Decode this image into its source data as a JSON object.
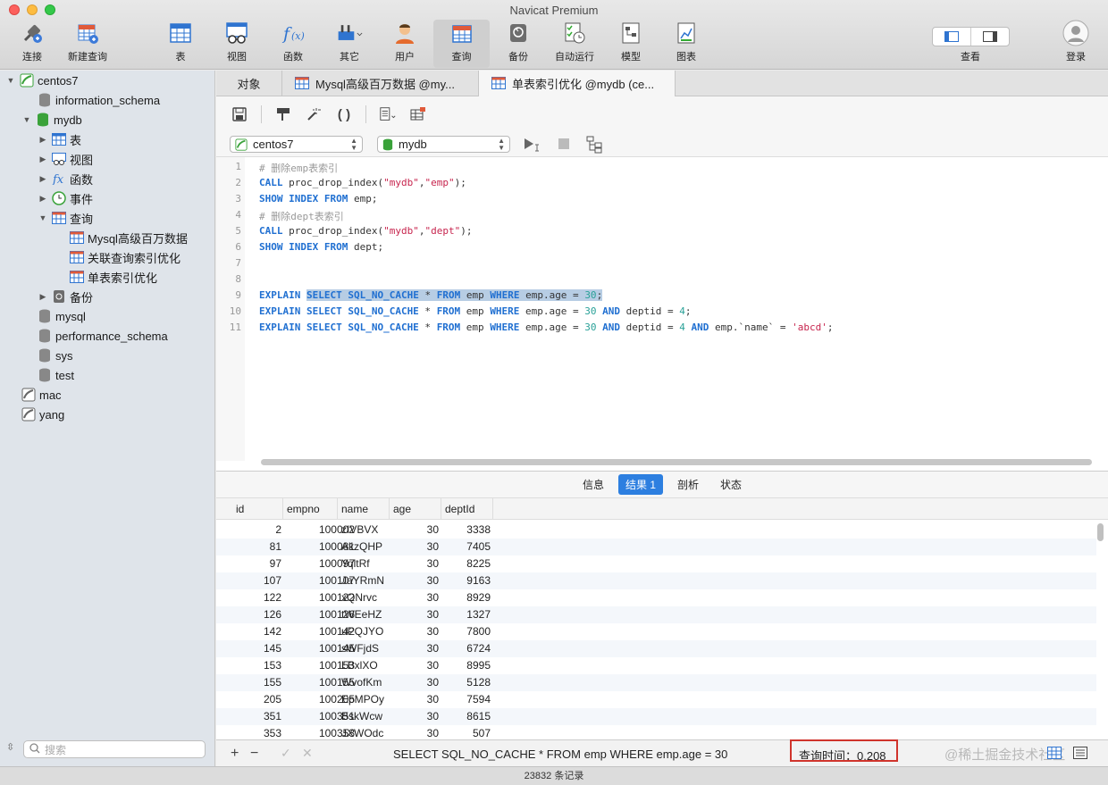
{
  "app_title": "Navicat Premium",
  "toolbar": {
    "connect": "连接",
    "new_query": "新建查询",
    "table": "表",
    "view": "视图",
    "function": "函数",
    "other": "其它",
    "user": "用户",
    "query": "查询",
    "backup": "备份",
    "auto_run": "自动运行",
    "model": "模型",
    "chart": "图表",
    "view_toggle": "查看",
    "login": "登录"
  },
  "sidebar": {
    "connection": "centos7",
    "databases": {
      "information_schema": "information_schema",
      "mydb": "mydb",
      "mysql": "mysql",
      "performance_schema": "performance_schema",
      "sys": "sys",
      "test": "test"
    },
    "mydb_children": {
      "tables": "表",
      "views": "视图",
      "functions": "函数",
      "events": "事件",
      "queries": "查询",
      "backups": "备份"
    },
    "queries": [
      "Mysql高级百万数据",
      "关联查询索引优化",
      "单表索引优化"
    ],
    "other_connections": [
      "mac",
      "yang"
    ],
    "search_placeholder": "搜索"
  },
  "tabs": [
    "对象",
    "Mysql高级百万数据 @my...",
    "单表索引优化 @mydb (ce..."
  ],
  "combos": {
    "connection": "centos7",
    "database": "mydb"
  },
  "editor": {
    "line_numbers": [
      "1",
      "2",
      "3",
      "4",
      "5",
      "6",
      "7",
      "8",
      "9",
      "10",
      "11"
    ]
  },
  "result_tabs": [
    "信息",
    "结果 1",
    "剖析",
    "状态"
  ],
  "grid": {
    "columns": [
      "id",
      "empno",
      "name",
      "age",
      "deptId"
    ],
    "rows": [
      [
        "2",
        "100002",
        "zIVBVX",
        "30",
        "3338"
      ],
      [
        "81",
        "100081",
        "AkzQHP",
        "30",
        "7405"
      ],
      [
        "97",
        "100097",
        "YqltRf",
        "30",
        "8225"
      ],
      [
        "107",
        "100107",
        "JaYRmN",
        "30",
        "9163"
      ],
      [
        "122",
        "100122",
        "xQNrvc",
        "30",
        "8929"
      ],
      [
        "126",
        "100126",
        "tWEeHZ",
        "30",
        "1327"
      ],
      [
        "142",
        "100142",
        "uPQJYO",
        "30",
        "7800"
      ],
      [
        "145",
        "100145",
        "sWFjdS",
        "30",
        "6724"
      ],
      [
        "153",
        "100153",
        "LBxlXO",
        "30",
        "8995"
      ],
      [
        "155",
        "100155",
        "WvofKm",
        "30",
        "5128"
      ],
      [
        "205",
        "100205",
        "EpMPOy",
        "30",
        "7594"
      ],
      [
        "351",
        "100351",
        "BskWcw",
        "30",
        "8615"
      ],
      [
        "353",
        "100353",
        "JXWOdc",
        "30",
        "507"
      ]
    ]
  },
  "bottom": {
    "sql": "SELECT SQL_NO_CACHE * FROM emp WHERE emp.age = 30",
    "query_time": "查询时间：0.208",
    "watermark": "@稀土掘金技术社区"
  },
  "status_bar": "23832 条记录"
}
